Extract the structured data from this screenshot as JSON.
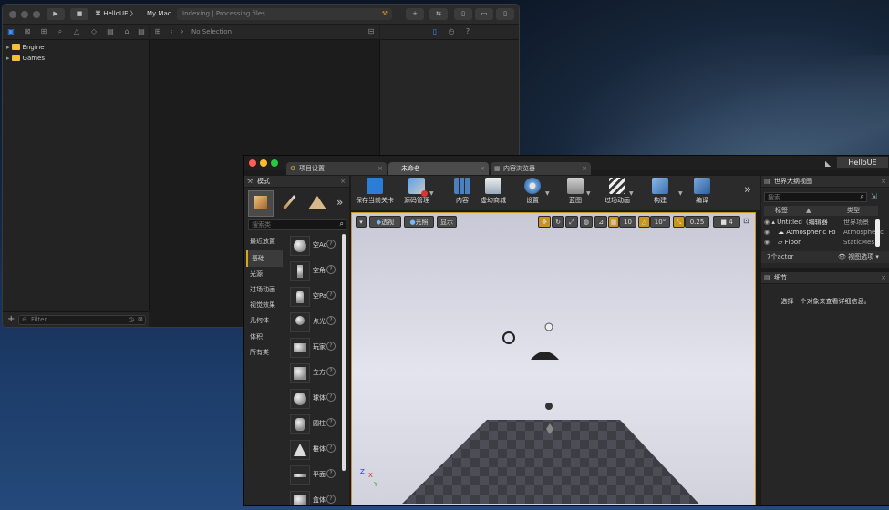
{
  "xcode": {
    "scheme": "HelloUE",
    "destination": "My Mac",
    "status": "Indexing | Processing files",
    "jump_bar": "No Selection",
    "tree": [
      {
        "label": "Engine"
      },
      {
        "label": "Games"
      }
    ],
    "filter_placeholder": "Filter"
  },
  "ue": {
    "project_name": "HelloUE",
    "tabs": [
      {
        "label": "项目设置"
      },
      {
        "label": "未命名"
      },
      {
        "label": "内容浏览器"
      }
    ],
    "modes_title": "模式",
    "search_placeholder": "搜索类",
    "categories": [
      {
        "label": "最近放置"
      },
      {
        "label": "基础"
      },
      {
        "label": "光源"
      },
      {
        "label": "过场动画"
      },
      {
        "label": "视觉效果"
      },
      {
        "label": "几何体"
      },
      {
        "label": "体积"
      },
      {
        "label": "所有类"
      }
    ],
    "assets": [
      {
        "label": "空Ac"
      },
      {
        "label": "空角"
      },
      {
        "label": "空Pa"
      },
      {
        "label": "点光"
      },
      {
        "label": "玩家"
      },
      {
        "label": "立方"
      },
      {
        "label": "球体"
      },
      {
        "label": "圆柱"
      },
      {
        "label": "椎体"
      },
      {
        "label": "平面"
      },
      {
        "label": "盒体"
      }
    ],
    "toolbar": [
      {
        "label": "保存当前关卡",
        "icon": "save-icon"
      },
      {
        "label": "源码管理",
        "icon": "source-control-icon"
      },
      {
        "label": "内容",
        "icon": "content-icon"
      },
      {
        "label": "虚幻商城",
        "icon": "marketplace-icon"
      },
      {
        "label": "设置",
        "icon": "settings-icon"
      },
      {
        "label": "蓝图",
        "icon": "blueprint-icon"
      },
      {
        "label": "过场动画",
        "icon": "cinematics-icon"
      },
      {
        "label": "构建",
        "icon": "build-icon"
      },
      {
        "label": "编译",
        "icon": "compile-icon"
      }
    ],
    "viewport": {
      "perspective": "透视",
      "lit": "光照",
      "show": "显示",
      "grid_snap": "10",
      "rot_snap": "10°",
      "scale_snap": "0.25",
      "cam_speed": "4",
      "axis_x": "X",
      "axis_y": "Y",
      "axis_z": "Z"
    },
    "outliner": {
      "title": "世界大纲视图",
      "search_placeholder": "搜索",
      "col_label": "标签",
      "col_type": "类型",
      "rows": [
        {
          "label": "Untitled（编辑器",
          "type": "世界场景"
        },
        {
          "label": "Atmospheric Fo",
          "type": "Atmospheric"
        },
        {
          "label": "Floor",
          "type": "StaticMes"
        }
      ],
      "count": "7个actor",
      "view_options": "视图选项"
    },
    "details": {
      "title": "细节",
      "empty_text": "选择一个对象来查看详细信息。"
    }
  }
}
